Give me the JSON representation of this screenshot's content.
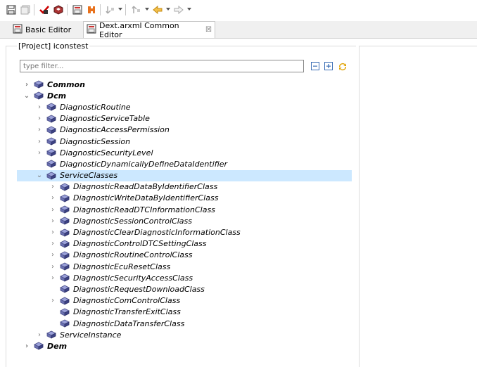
{
  "toolbar": {
    "icons": [
      "save-icon",
      "save-all-icon",
      "validate-icon",
      "generate-icon",
      "new-editor-icon",
      "plugin-icon",
      "next-annotation-icon",
      "prev-annotation-icon",
      "back-icon",
      "forward-icon"
    ]
  },
  "tabs": [
    {
      "label": "Basic Editor",
      "active": false
    },
    {
      "label": "Dext.arxml Common Editor",
      "active": true,
      "close": "☒"
    }
  ],
  "panel": {
    "title": "[Project] iconstest"
  },
  "filter": {
    "placeholder": "type filter text",
    "value": "",
    "display": "type filter..."
  },
  "tree": [
    {
      "label": "Common",
      "level": 0,
      "twisty": "›",
      "expanded": false
    },
    {
      "label": "Dcm",
      "level": 0,
      "twisty": "⌄",
      "expanded": true
    },
    {
      "label": "DiagnosticRoutine",
      "level": 1,
      "twisty": "›"
    },
    {
      "label": "DiagnosticServiceTable",
      "level": 1,
      "twisty": "›"
    },
    {
      "label": "DiagnosticAccessPermission",
      "level": 1,
      "twisty": "›"
    },
    {
      "label": "DiagnosticSession",
      "level": 1,
      "twisty": "›"
    },
    {
      "label": "DiagnosticSecurityLevel",
      "level": 1,
      "twisty": "›"
    },
    {
      "label": "DiagnosticDynamicallyDefineDataIdentifier",
      "level": 1,
      "twisty": ""
    },
    {
      "label": "ServiceClasses",
      "level": 1,
      "twisty": "⌄",
      "selected": true
    },
    {
      "label": "DiagnosticReadDataByIdentifierClass",
      "level": 2,
      "twisty": "›"
    },
    {
      "label": "DiagnosticWriteDataByIdentifierClass",
      "level": 2,
      "twisty": "›"
    },
    {
      "label": "DiagnosticReadDTCInformationClass",
      "level": 2,
      "twisty": "›"
    },
    {
      "label": "DiagnosticSessionControlClass",
      "level": 2,
      "twisty": "›"
    },
    {
      "label": "DiagnosticClearDiagnosticInformationClass",
      "level": 2,
      "twisty": "›"
    },
    {
      "label": "DiagnosticControlDTCSettingClass",
      "level": 2,
      "twisty": "›"
    },
    {
      "label": "DiagnosticRoutineControlClass",
      "level": 2,
      "twisty": "›"
    },
    {
      "label": "DiagnosticEcuResetClass",
      "level": 2,
      "twisty": "›"
    },
    {
      "label": "DiagnosticSecurityAccessClass",
      "level": 2,
      "twisty": "›"
    },
    {
      "label": "DiagnosticRequestDownloadClass",
      "level": 2,
      "twisty": ""
    },
    {
      "label": "DiagnosticComControlClass",
      "level": 2,
      "twisty": "›"
    },
    {
      "label": "DiagnosticTransferExitClass",
      "level": 2,
      "twisty": ""
    },
    {
      "label": "DiagnosticDataTransferClass",
      "level": 2,
      "twisty": ""
    },
    {
      "label": "ServiceInstance",
      "level": 1,
      "twisty": "›"
    },
    {
      "label": "Dem",
      "level": 0,
      "twisty": "›"
    }
  ],
  "colors": {
    "selection": "#cce8ff",
    "node_icon": "#7a7fb8"
  }
}
